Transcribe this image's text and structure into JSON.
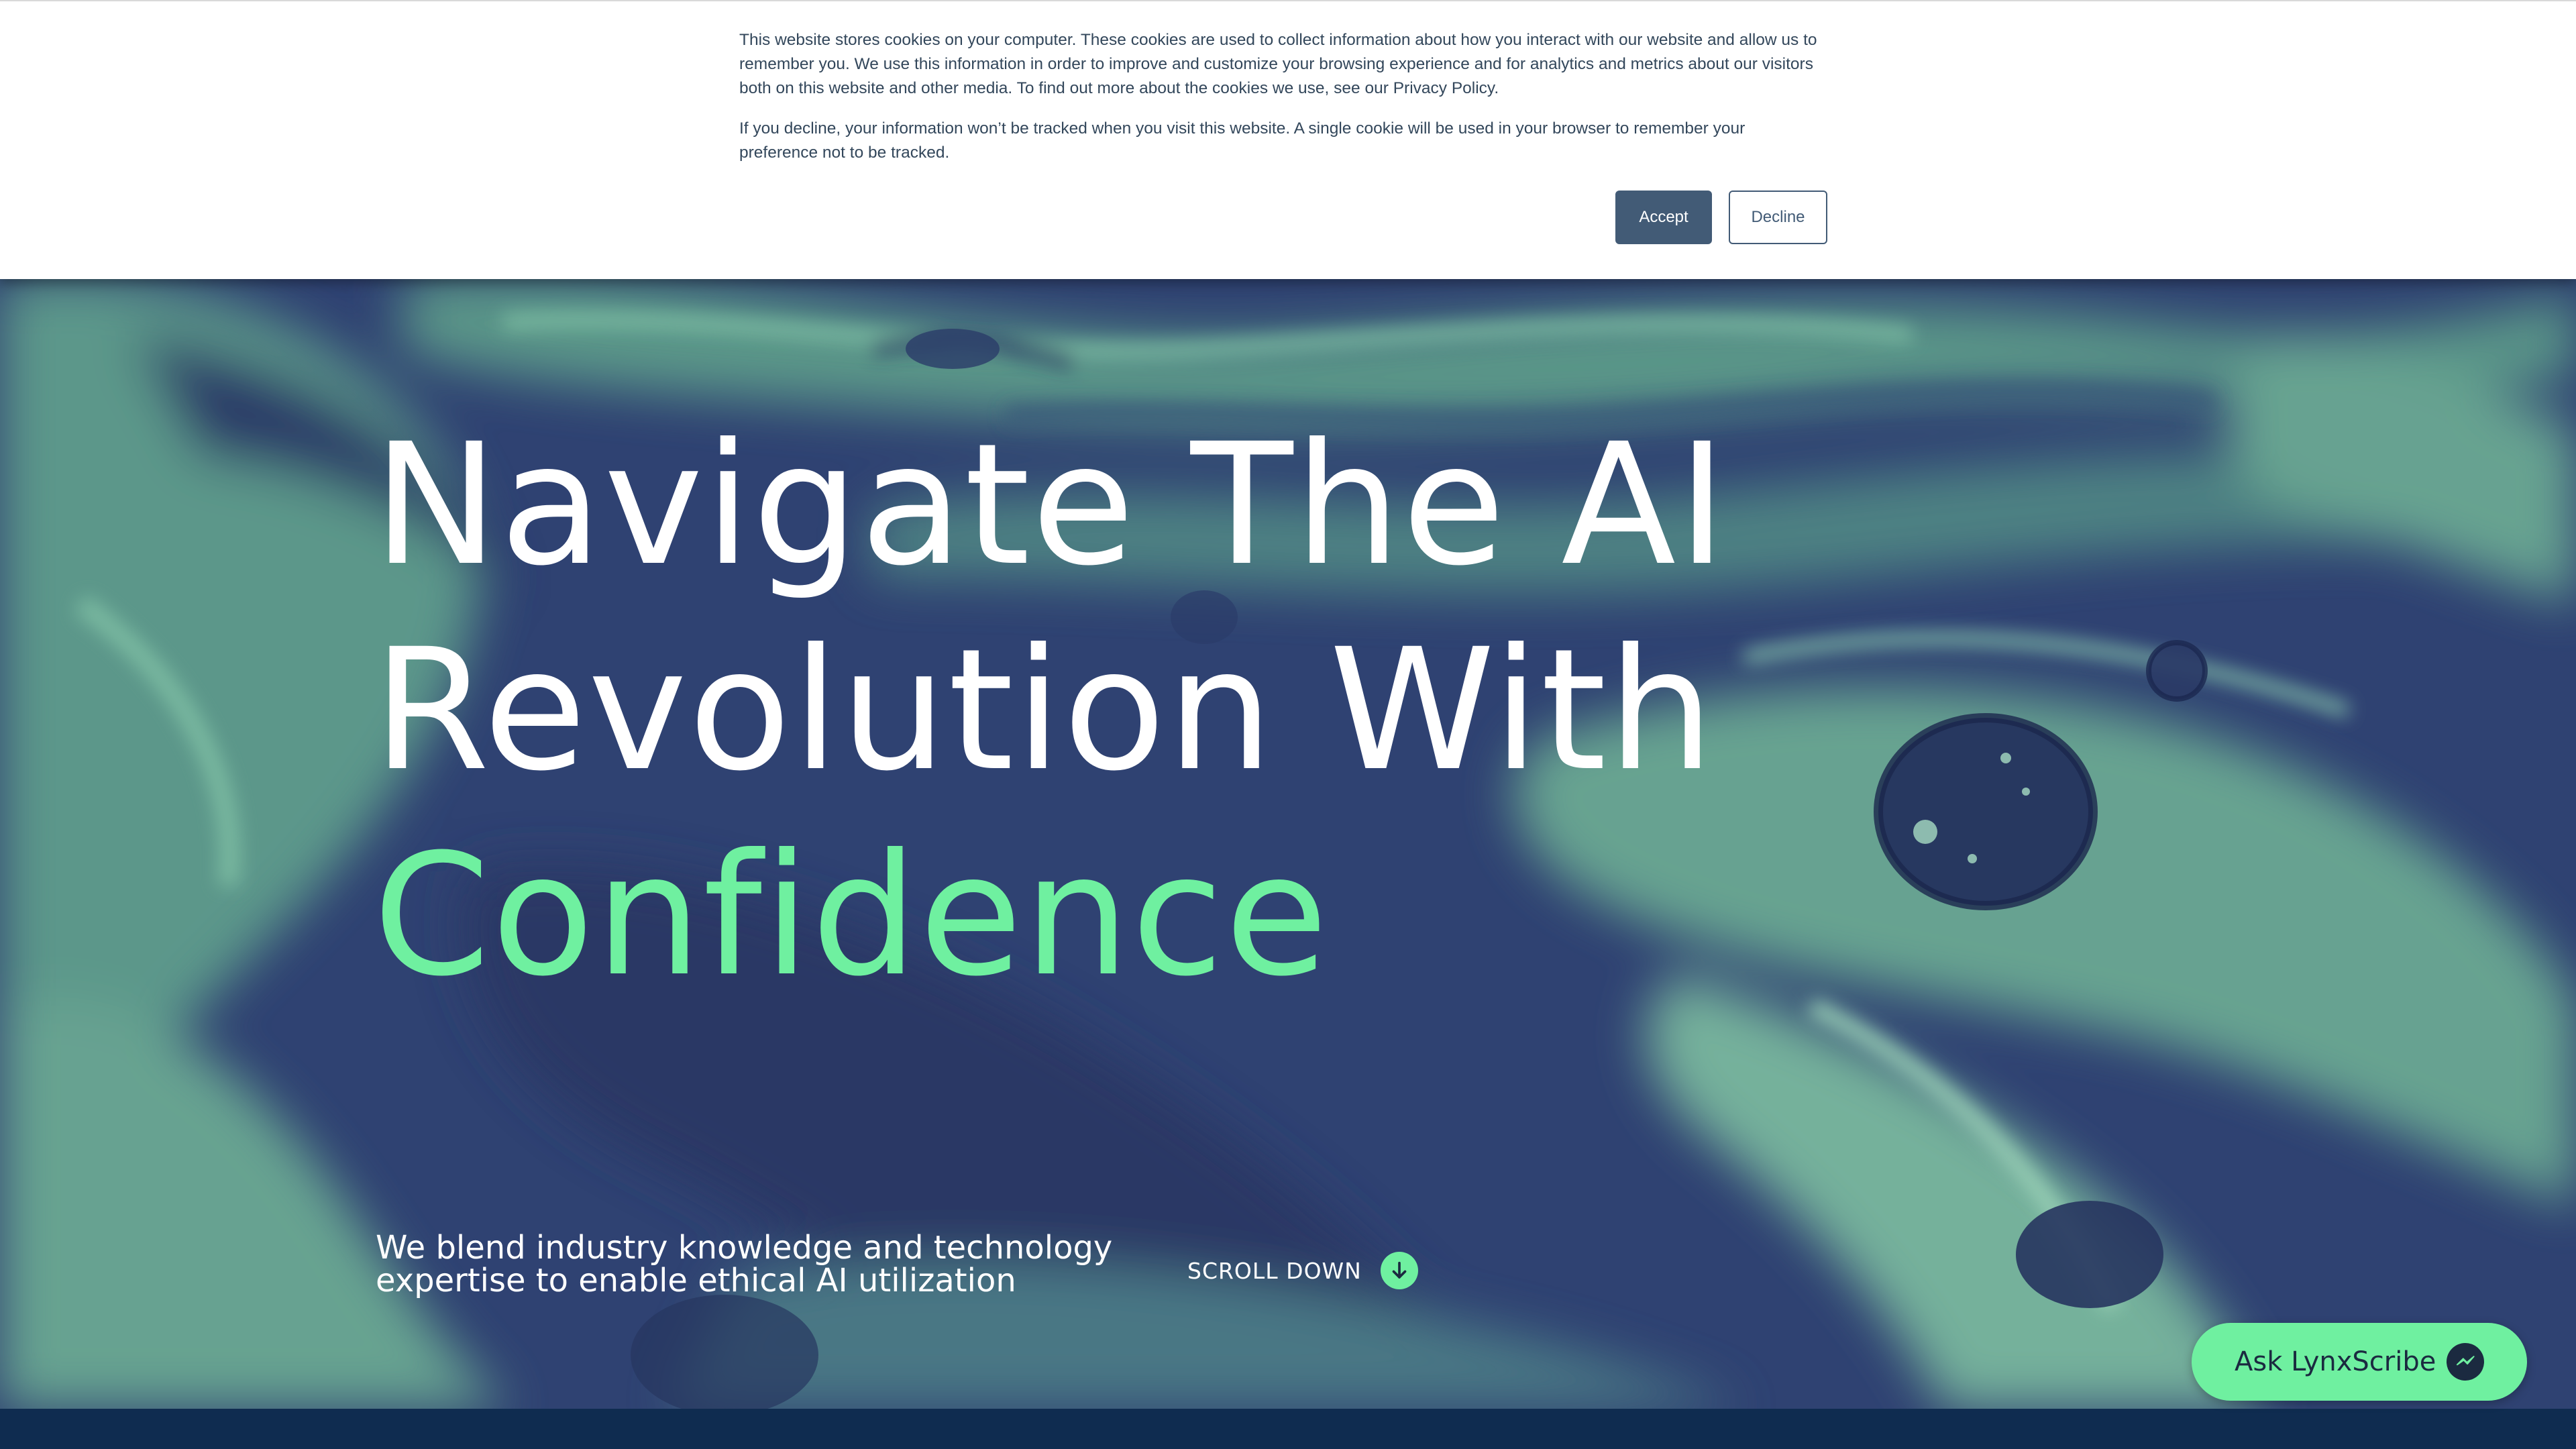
{
  "cookie_banner": {
    "paragraph_1": "This website stores cookies on your computer. These cookies are used to collect information about how you interact with our website and allow us to remember you. We use this information in order to improve and customize your browsing experience and for analytics and metrics about our visitors both on this website and other media. To find out more about the cookies we use, see our Privacy Policy.",
    "paragraph_2": "If you decline, your information won’t be tracked when you visit this website. A single cookie will be used in your browser to remember your preference not to be tracked.",
    "accept_label": "Accept",
    "decline_label": "Decline"
  },
  "hero": {
    "headline_line_1": "Navigate The AI",
    "headline_line_2": "Revolution With",
    "headline_accent": "Confidence",
    "tagline_line_1": "We blend industry knowledge and technology",
    "tagline_line_2": "expertise to enable ethical AI utilization",
    "scroll_label": "SCROLL DOWN",
    "scroll_icon": "arrow-down-circle-icon"
  },
  "chat": {
    "label": "Ask LynxScribe",
    "icon": "messenger-icon"
  },
  "colors": {
    "accent_green": "#6ff0a0",
    "navy": "#2d3f6e",
    "button_slate": "#425b76",
    "bottom_band": "#0f2c50"
  }
}
